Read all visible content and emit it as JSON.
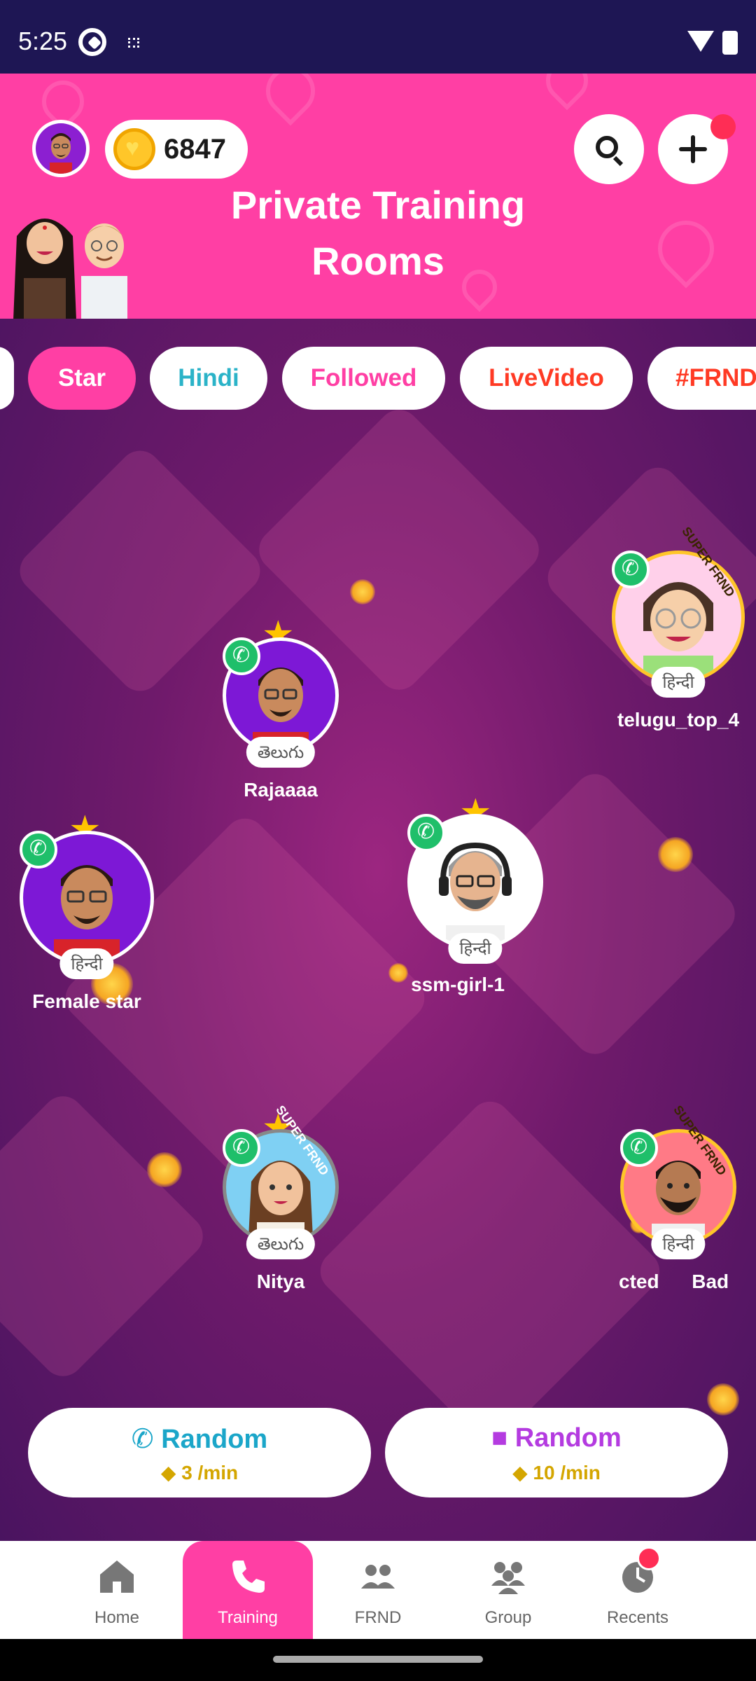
{
  "status_bar": {
    "time": "5:25"
  },
  "header": {
    "title_line1": "Private Training",
    "title_line2": "Rooms",
    "coins": "6847"
  },
  "filter_chips": [
    {
      "label": "Star",
      "color": "#ffffff",
      "active": true
    },
    {
      "label": "Hindi",
      "color": "#2bb3c8",
      "active": false
    },
    {
      "label": "Followed",
      "color": "#ff3fa4",
      "active": false
    },
    {
      "label": "LiveVideo",
      "color": "#ff3a24",
      "active": false
    },
    {
      "label": "#FRND",
      "color": "#ff3a24",
      "active": false
    }
  ],
  "users": [
    {
      "name": "telugu_top_4",
      "language": "हिन्दी",
      "badge": "SUPER FRND",
      "starred": false
    },
    {
      "name": "Rajaaaa",
      "language": "తెలుగు",
      "starred": true
    },
    {
      "name": "Female star",
      "language": "हिन्दी",
      "starred": true
    },
    {
      "name": "ssm-girl-1",
      "language": "हिन्दी",
      "starred": true
    },
    {
      "name": "Nitya",
      "language": "తెలుగు",
      "badge": "SUPER FRND",
      "starred": true
    },
    {
      "name": "cted      Bad",
      "language": "हिन्दी",
      "badge": "SUPER FRND",
      "starred": false
    }
  ],
  "random_audio": {
    "label": "Random",
    "rate": "3 /min",
    "accent": "#1ba6c9"
  },
  "random_video": {
    "label": "Random",
    "rate": "10 /min",
    "accent": "#b43be0"
  },
  "bottom_nav": [
    {
      "label": "Home",
      "icon": "home-icon",
      "active": false
    },
    {
      "label": "Training",
      "icon": "phone-icon",
      "active": true
    },
    {
      "label": "FRND",
      "icon": "friends-icon",
      "active": false
    },
    {
      "label": "Group",
      "icon": "group-icon",
      "active": false
    },
    {
      "label": "Recents",
      "icon": "clock-icon",
      "active": false
    }
  ],
  "colors": {
    "brand_pink": "#ff3fa4",
    "call_green": "#1fbf6a",
    "gold": "#d4a600"
  }
}
